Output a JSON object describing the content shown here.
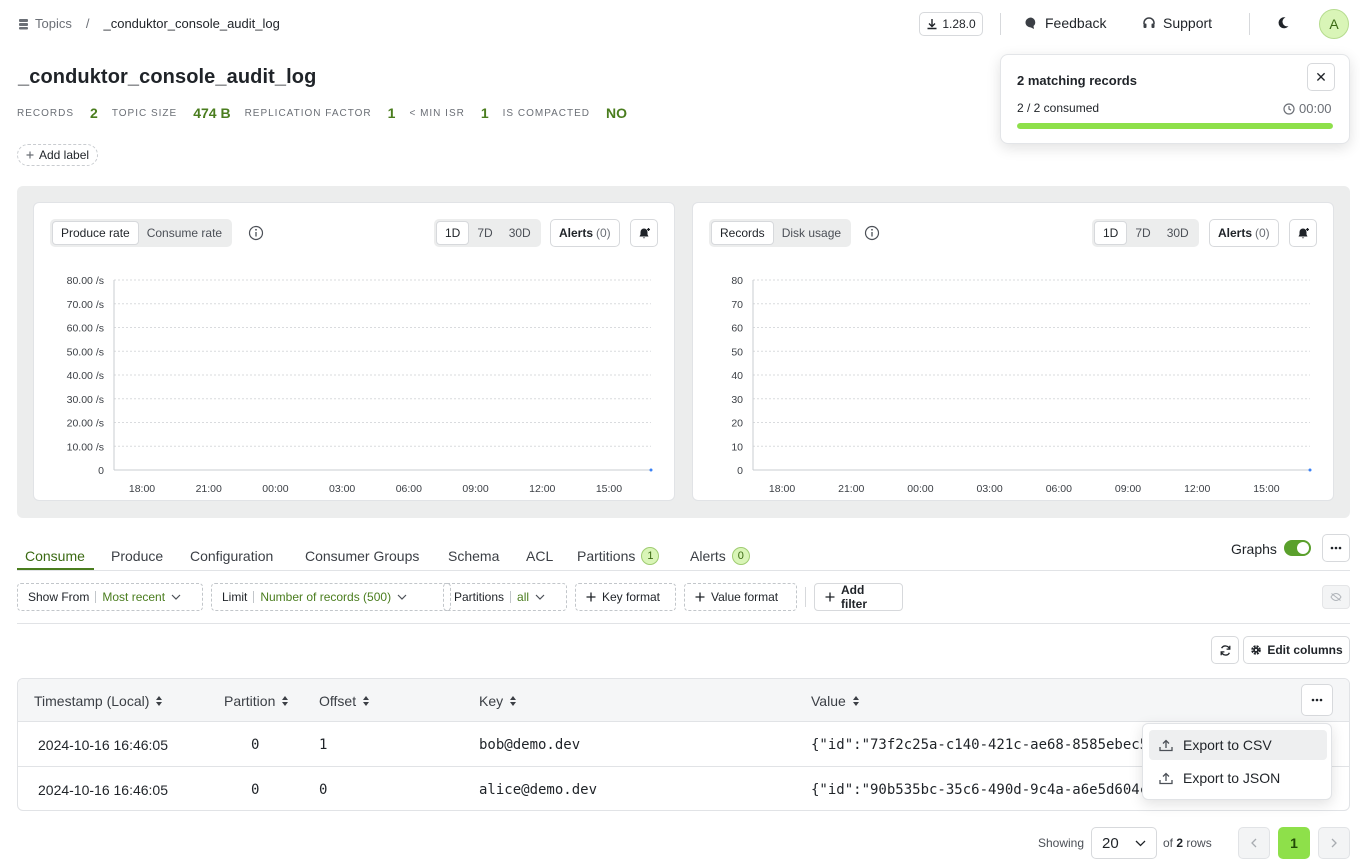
{
  "breadcrumb": {
    "root": "Topics",
    "separator": "/",
    "current": "_conduktor_console_audit_log"
  },
  "header": {
    "version": "1.28.0",
    "feedback": "Feedback",
    "support": "Support",
    "avatar_initial": "A"
  },
  "topic": {
    "title": "_conduktor_console_audit_log",
    "stats": [
      {
        "label": "RECORDS",
        "value": "2"
      },
      {
        "label": "TOPIC SIZE",
        "value": "474 B"
      },
      {
        "label": "REPLICATION FACTOR",
        "value": "1"
      },
      {
        "label": "< MIN ISR",
        "value": "1"
      },
      {
        "label": "IS COMPACTED",
        "value": "NO"
      }
    ],
    "add_label": "Add label"
  },
  "toast": {
    "title": "2 matching records",
    "close": "✕",
    "consumed": "2 / 2 consumed",
    "time": "00:00",
    "progress": 1.0
  },
  "charts": {
    "left": {
      "seg": [
        "Produce rate",
        "Consume rate"
      ],
      "ranges": [
        "1D",
        "7D",
        "30D"
      ],
      "alerts": "Alerts",
      "alerts_count": "(0)"
    },
    "right": {
      "seg": [
        "Records",
        "Disk usage"
      ],
      "ranges": [
        "1D",
        "7D",
        "30D"
      ],
      "alerts": "Alerts",
      "alerts_count": "(0)"
    }
  },
  "chart_data": [
    {
      "type": "line",
      "title": "",
      "xlabel": "",
      "ylabel": "",
      "x_ticks": [
        "18:00",
        "21:00",
        "00:00",
        "03:00",
        "06:00",
        "09:00",
        "12:00",
        "15:00"
      ],
      "y_ticks": [
        "0",
        "10.00 /s",
        "20.00 /s",
        "30.00 /s",
        "40.00 /s",
        "50.00 /s",
        "60.00 /s",
        "70.00 /s",
        "80.00 /s"
      ],
      "ylim": [
        0,
        80
      ],
      "grid": true,
      "series": [
        {
          "values": [
            0
          ]
        }
      ]
    },
    {
      "type": "line",
      "title": "",
      "xlabel": "",
      "ylabel": "",
      "x_ticks": [
        "18:00",
        "21:00",
        "00:00",
        "03:00",
        "06:00",
        "09:00",
        "12:00",
        "15:00"
      ],
      "y_ticks": [
        "0",
        "10",
        "20",
        "30",
        "40",
        "50",
        "60",
        "70",
        "80"
      ],
      "ylim": [
        0,
        80
      ],
      "grid": true,
      "series": [
        {
          "values": [
            0
          ]
        }
      ]
    }
  ],
  "tabs": [
    {
      "label": "Consume"
    },
    {
      "label": "Produce"
    },
    {
      "label": "Configuration"
    },
    {
      "label": "Consumer Groups"
    },
    {
      "label": "Schema"
    },
    {
      "label": "ACL"
    },
    {
      "label": "Partitions",
      "badge": "1"
    },
    {
      "label": "Alerts",
      "badge": "0"
    }
  ],
  "graphs_toggle": {
    "label": "Graphs",
    "on": true
  },
  "filters": {
    "show_from": {
      "label": "Show From",
      "value": "Most recent"
    },
    "limit": {
      "label": "Limit",
      "value": "Number of records (500)"
    },
    "partitions": {
      "label": "Partitions",
      "value": "all"
    },
    "key_format": "Key format",
    "value_format": "Value format",
    "add_filter": "Add filter"
  },
  "toolbar": {
    "edit_columns": "Edit columns"
  },
  "table": {
    "columns": [
      "Timestamp (Local)",
      "Partition",
      "Offset",
      "Key",
      "Value"
    ],
    "rows": [
      {
        "timestamp": "2024-10-16 16:46:05",
        "partition": "0",
        "offset": "1",
        "key": "bob@demo.dev",
        "value": "{\"id\":\"73f2c25a-c140-421c-ae68-8585ebec5"
      },
      {
        "timestamp": "2024-10-16 16:46:05",
        "partition": "0",
        "offset": "0",
        "key": "alice@demo.dev",
        "value": "{\"id\":\"90b535bc-35c6-490d-9c4a-a6e5d604c"
      }
    ]
  },
  "menu": {
    "export_csv": "Export to CSV",
    "export_json": "Export to JSON"
  },
  "pagination": {
    "showing": "Showing",
    "page_size": "20",
    "of_prefix": "of",
    "total": "2",
    "rows_suffix": "rows",
    "current_page": "1"
  },
  "colors": {
    "accent": "#4a7d1e",
    "accent_bright": "#8ee04a",
    "toggle": "#5aa02c"
  }
}
